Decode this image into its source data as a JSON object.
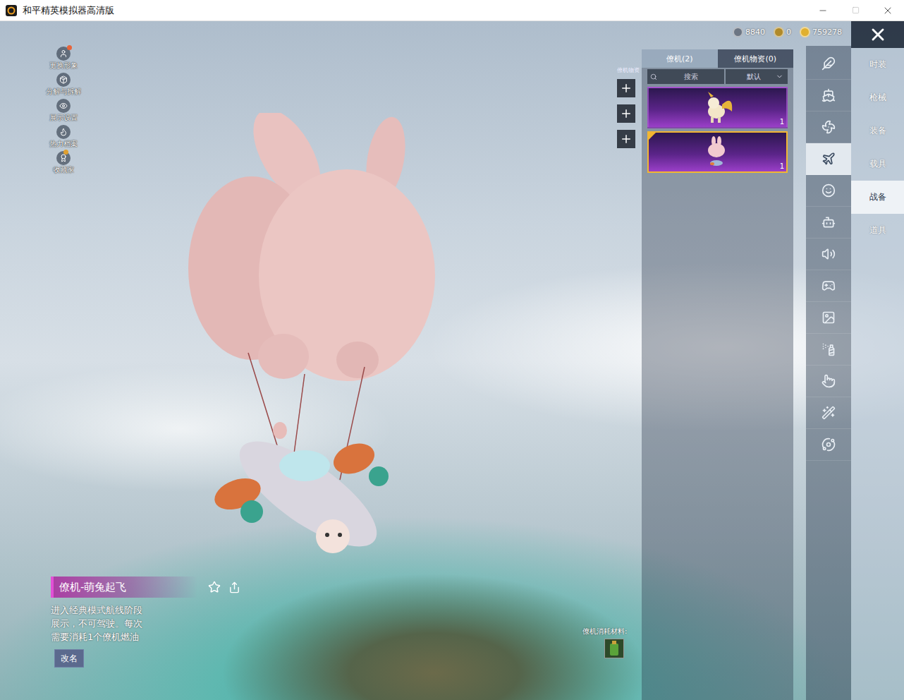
{
  "window": {
    "title": "和平精英模拟器高清版"
  },
  "currency": [
    {
      "value": "8840"
    },
    {
      "value": "0"
    },
    {
      "value": "759278"
    }
  ],
  "left_menu": [
    {
      "label": "更换形象",
      "badge": true
    },
    {
      "label": "分解与拆解",
      "badge": false
    },
    {
      "label": "展示设置",
      "badge": false
    },
    {
      "label": "热力档案",
      "badge": false
    },
    {
      "label": "收藏家",
      "badge": true
    }
  ],
  "slots": {
    "label": "僚机物资",
    "buttons": [
      {
        "empty": true
      },
      {
        "empty": true
      },
      {
        "empty": true
      }
    ]
  },
  "tabs": [
    {
      "label": "僚机(2)",
      "selected": true
    },
    {
      "label": "僚机物资(0)",
      "selected": false
    }
  ],
  "search": {
    "placeholder": "搜索"
  },
  "sort": {
    "value": "默认"
  },
  "items": [
    {
      "count": "1",
      "selected": false,
      "equipped": false
    },
    {
      "count": "1",
      "selected": true,
      "equipped": true
    }
  ],
  "category_icons": [
    {
      "selected": false
    },
    {
      "selected": false
    },
    {
      "selected": false
    },
    {
      "selected": true
    },
    {
      "selected": false
    },
    {
      "selected": false
    },
    {
      "selected": false
    },
    {
      "selected": false
    },
    {
      "selected": false
    },
    {
      "selected": false
    },
    {
      "selected": false
    },
    {
      "selected": false
    },
    {
      "selected": false
    }
  ],
  "nav": [
    {
      "label": "时装",
      "selected": false
    },
    {
      "label": "枪械",
      "selected": false
    },
    {
      "label": "装备",
      "selected": false
    },
    {
      "label": "载具",
      "selected": false
    },
    {
      "label": "战备",
      "selected": true
    },
    {
      "label": "道具",
      "selected": false
    }
  ],
  "detail": {
    "name": "僚机-萌兔起飞",
    "description": [
      "进入经典模式航线阶段",
      "展示，不可驾驶。每次",
      "需要消耗1个僚机燃油"
    ],
    "rename": "改名"
  },
  "materials": {
    "label": "僚机消耗材料:"
  }
}
